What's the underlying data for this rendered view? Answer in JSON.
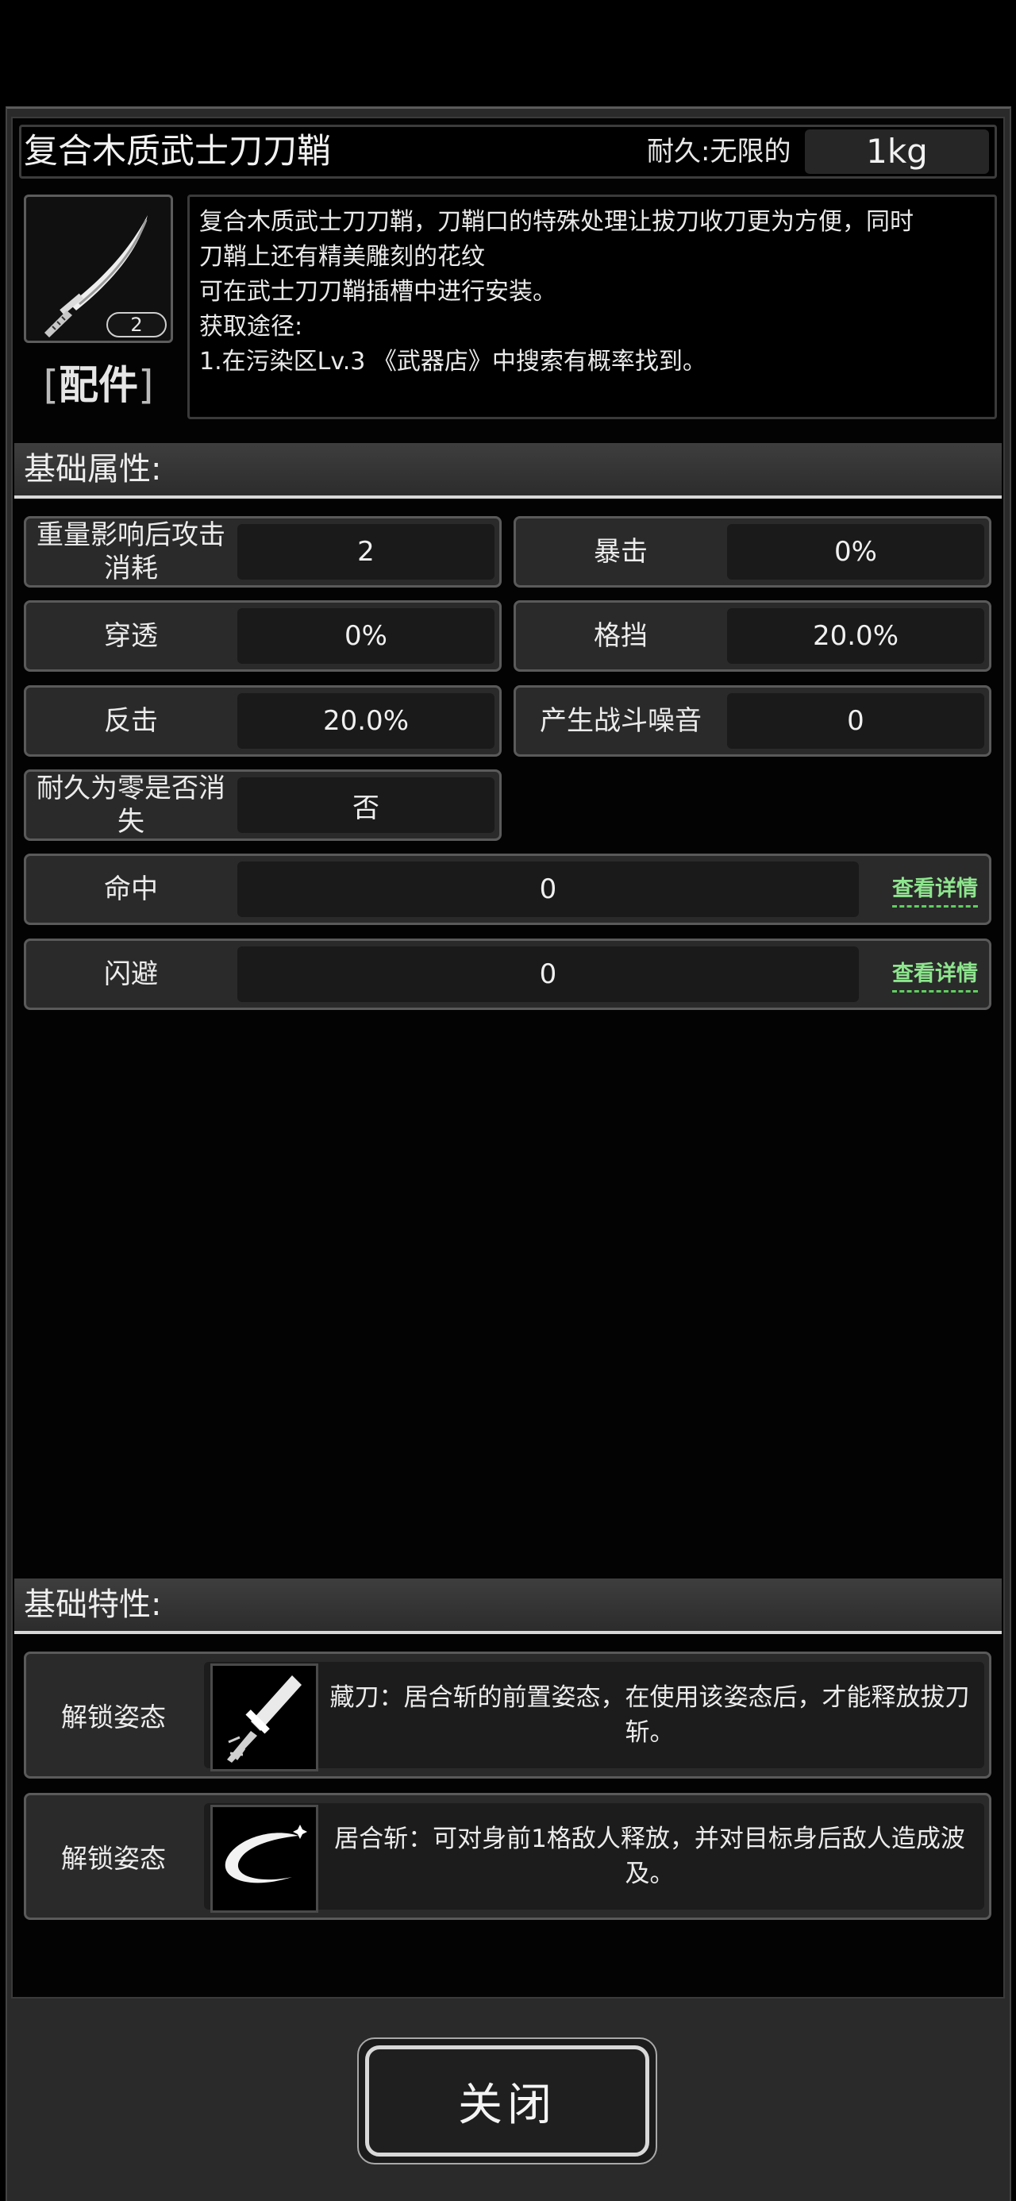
{
  "item": {
    "name": "复合木质武士刀刀鞘",
    "durability": "耐久:无限的",
    "weight": "1kg",
    "count": "2",
    "category_bracket_left": "[",
    "category": "配件",
    "category_bracket_right": "]",
    "description_lines": [
      "复合木质武士刀刀鞘，刀鞘口的特殊处理让拔刀收刀更为方便，同时",
      "刀鞘上还有精美雕刻的花纹",
      "可在武士刀刀鞘插槽中进行安装。",
      "获取途径:",
      "1.在污染区Lv.3 《武器店》中搜索有概率找到。"
    ],
    "icon": "katana-icon"
  },
  "basic_attributes": {
    "header": "基础属性:",
    "items": [
      {
        "label": "重量影响后攻击消耗",
        "value": "2"
      },
      {
        "label": "暴击",
        "value": "0%"
      },
      {
        "label": "穿透",
        "value": "0%"
      },
      {
        "label": "格挡",
        "value": "20.0%"
      },
      {
        "label": "反击",
        "value": "20.0%"
      },
      {
        "label": "产生战斗噪音",
        "value": "0"
      },
      {
        "label": "耐久为零是否消失",
        "value": "否"
      }
    ],
    "wide_items": [
      {
        "label": "命中",
        "value": "0",
        "link": "查看详情"
      },
      {
        "label": "闪避",
        "value": "0",
        "link": "查看详情"
      }
    ]
  },
  "basic_traits": {
    "header": "基础特性:",
    "items": [
      {
        "label": "解锁姿态",
        "icon": "sheathed-sword-icon",
        "text": "藏刀：居合斩的前置姿态，在使用该姿态后，才能释放拔刀斩。"
      },
      {
        "label": "解锁姿态",
        "icon": "slash-arc-icon",
        "text": "居合斩：可对身前1格敌人释放，并对目标身后敌人造成波及。"
      }
    ]
  },
  "footer": {
    "close_label": "关闭"
  },
  "colors": {
    "link": "#8ee58e",
    "panel": "#2a2a2a",
    "background": "#000000"
  }
}
